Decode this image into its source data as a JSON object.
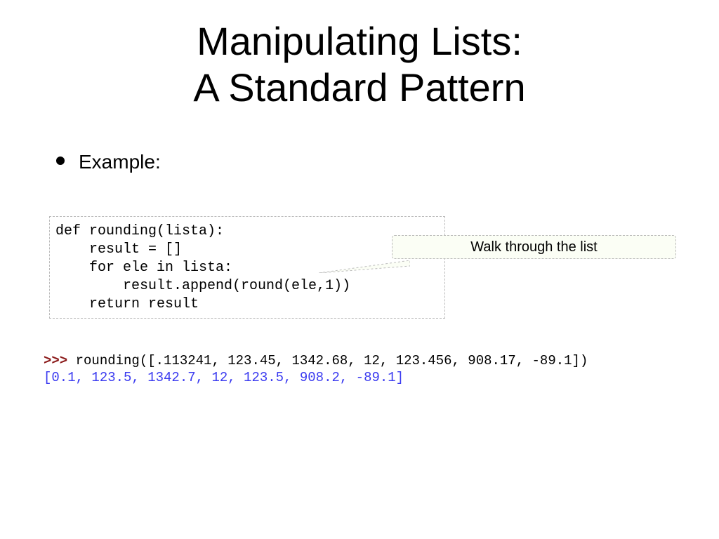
{
  "title_line1": "Manipulating Lists:",
  "title_line2": "A Standard Pattern",
  "bullet": "Example:",
  "code": {
    "l1": "def rounding(lista):",
    "l2": "    result = []",
    "l3": "    for ele in lista:",
    "l4": "        result.append(round(ele,1))",
    "l5": "    return result"
  },
  "callout": "Walk through the list",
  "repl": {
    "prompt": ">>>",
    "input": " rounding([.113241, 123.45, 1342.68, 12, 123.456, 908.17, -89.1])",
    "output": "[0.1, 123.5, 1342.7, 12, 123.5, 908.2, -89.1]"
  }
}
